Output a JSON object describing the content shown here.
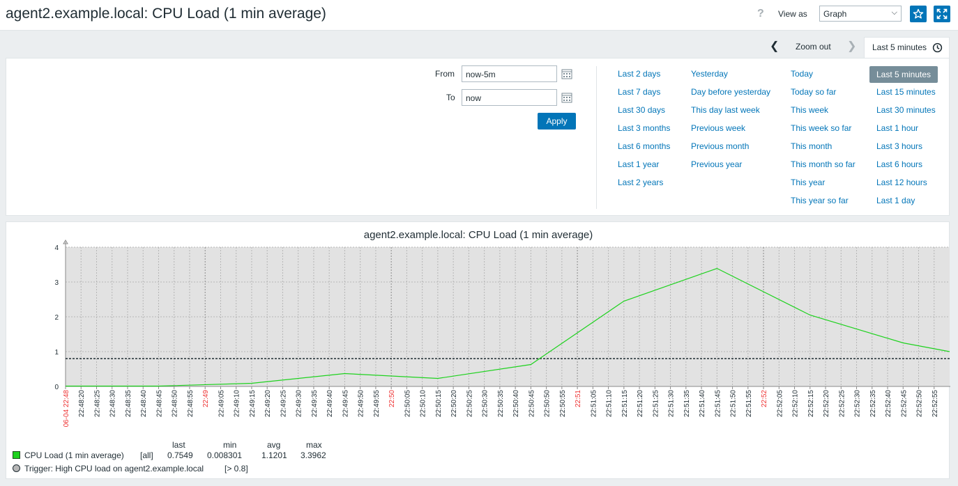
{
  "header": {
    "title": "agent2.example.local: CPU Load (1 min average)",
    "help": "?",
    "view_as_label": "View as",
    "view_as_value": "Graph",
    "favorite_icon": "star-icon",
    "fullscreen_icon": "fullscreen-icon"
  },
  "timebar": {
    "zoom_out": "Zoom out",
    "active_tab": "Last 5 minutes",
    "prev_icon": "chevron-left-icon",
    "next_icon": "chevron-right-icon",
    "clock_icon": "clock-icon"
  },
  "filter": {
    "from_label": "From",
    "from_value": "now-5m",
    "to_label": "To",
    "to_value": "now",
    "apply": "Apply",
    "quick_ranges": {
      "col1": [
        "Last 2 days",
        "Last 7 days",
        "Last 30 days",
        "Last 3 months",
        "Last 6 months",
        "Last 1 year",
        "Last 2 years"
      ],
      "col2": [
        "Yesterday",
        "Day before yesterday",
        "This day last week",
        "Previous week",
        "Previous month",
        "Previous year"
      ],
      "col3": [
        "Today",
        "Today so far",
        "This week",
        "This week so far",
        "This month",
        "This month so far",
        "This year",
        "This year so far"
      ],
      "col4": [
        "Last 5 minutes",
        "Last 15 minutes",
        "Last 30 minutes",
        "Last 1 hour",
        "Last 3 hours",
        "Last 6 hours",
        "Last 12 hours",
        "Last 1 day"
      ]
    },
    "selected_range": "Last 5 minutes"
  },
  "chart_data": {
    "type": "line",
    "title": "agent2.example.local: CPU Load (1 min average)",
    "ylim": [
      0,
      4
    ],
    "y_ticks": [
      "0",
      "1",
      "2",
      "3",
      "4"
    ],
    "x_tick_labels": [
      "06-04 22:48",
      "22:48:20",
      "22:48:25",
      "22:48:30",
      "22:48:35",
      "22:48:40",
      "22:48:45",
      "22:48:50",
      "22:48:55",
      "22:49",
      "22:49:05",
      "22:49:10",
      "22:49:15",
      "22:49:20",
      "22:49:25",
      "22:49:30",
      "22:49:35",
      "22:49:40",
      "22:49:45",
      "22:49:50",
      "22:49:55",
      "22:50",
      "22:50:05",
      "22:50:10",
      "22:50:15",
      "22:50:20",
      "22:50:25",
      "22:50:30",
      "22:50:35",
      "22:50:40",
      "22:50:45",
      "22:50:50",
      "22:50:55",
      "22:51",
      "22:51:05",
      "22:51:10",
      "22:51:15",
      "22:51:20",
      "22:51:25",
      "22:51:30",
      "22:51:35",
      "22:51:40",
      "22:51:45",
      "22:51:50",
      "22:51:55",
      "22:52",
      "22:52:05",
      "22:52:10",
      "22:52:15",
      "22:52:20",
      "22:52:25",
      "22:52:30",
      "22:52:35",
      "22:52:40",
      "22:52:45",
      "22:52:50",
      "22:52:55"
    ],
    "red_tick_labels": [
      "06-04 22:48",
      "22:49",
      "22:50",
      "22:51",
      "22:52"
    ],
    "series": [
      {
        "name": "CPU Load (1 min average)",
        "color": "#1ed21e",
        "points": [
          [
            "22:48:15",
            0.01
          ],
          [
            "22:48:45",
            0.01
          ],
          [
            "22:49:15",
            0.09
          ],
          [
            "22:49:45",
            0.37
          ],
          [
            "22:50:15",
            0.23
          ],
          [
            "22:50:45",
            0.63
          ],
          [
            "22:51:15",
            2.45
          ],
          [
            "22:51:45",
            3.39
          ],
          [
            "22:52:15",
            2.05
          ],
          [
            "22:52:45",
            1.25
          ],
          [
            "22:53:00",
            1.0
          ]
        ]
      }
    ],
    "trigger": {
      "value": 0.8,
      "color": "#1f2c33"
    },
    "legend": {
      "headers": [
        "last",
        "min",
        "avg",
        "max"
      ],
      "item_name": "CPU Load (1 min average)",
      "item_func": "[all]",
      "values": [
        "0.7549",
        "0.008301",
        "1.1201",
        "3.3962"
      ],
      "trigger_text": "Trigger: High CPU load on agent2.example.local",
      "trigger_cond": "[> 0.8]"
    }
  }
}
